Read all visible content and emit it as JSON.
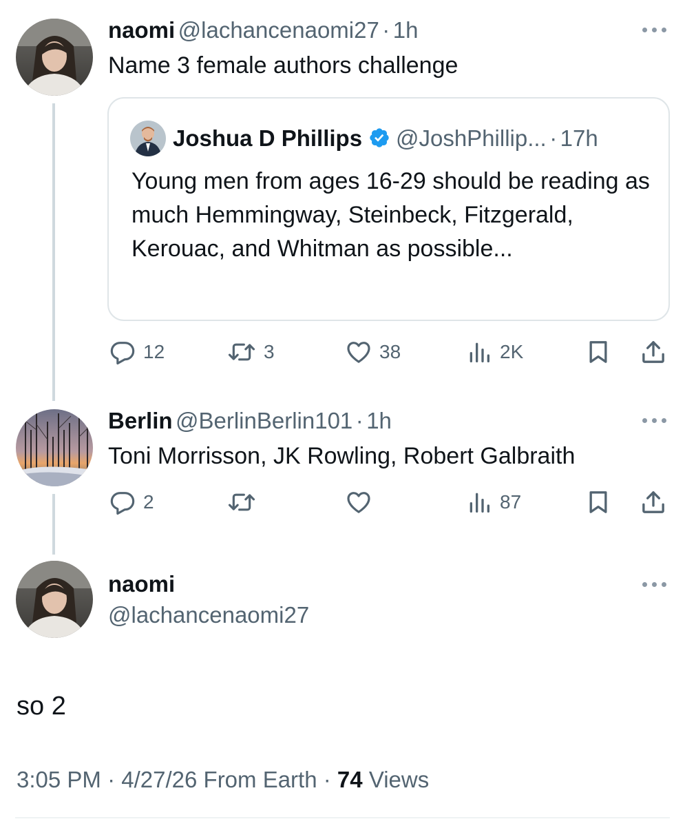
{
  "thread": {
    "tweet1": {
      "name": "naomi",
      "handle": "@lachancenaomi27",
      "separator": "·",
      "time": "1h",
      "text": "Name 3 female authors challenge",
      "quote": {
        "name": "Joshua D Phillips",
        "verified_icon": "verified-badge-icon",
        "handle": "@JoshPhillip...",
        "separator": "·",
        "time": "17h",
        "text": "Young men from ages 16-29 should be reading as much Hemmingway, Steinbeck, Fitzgerald, Kerouac, and Whitman as possible..."
      },
      "actions": {
        "replies": "12",
        "reposts": "3",
        "likes": "38",
        "views": "2K"
      }
    },
    "tweet2": {
      "name": "Berlin",
      "handle": "@BerlinBerlin101",
      "separator": "·",
      "time": "1h",
      "text": "Toni Morrisson, JK Rowling, Robert Galbraith",
      "actions": {
        "replies": "2",
        "reposts": "",
        "likes": "",
        "views": "87"
      }
    },
    "main": {
      "name": "naomi",
      "handle": "@lachancenaomi27",
      "text": "so 2",
      "time": "3:05 PM",
      "sep1": "·",
      "date": "4/27/26",
      "source": "From Earth",
      "sep2": "·",
      "views_count": "74",
      "views_label": "Views"
    }
  },
  "colors": {
    "text": "#0f1419",
    "secondary": "#536471",
    "verified": "#1d9bf0",
    "border": "#dfe5e8",
    "thread_line": "#cfd9de"
  }
}
